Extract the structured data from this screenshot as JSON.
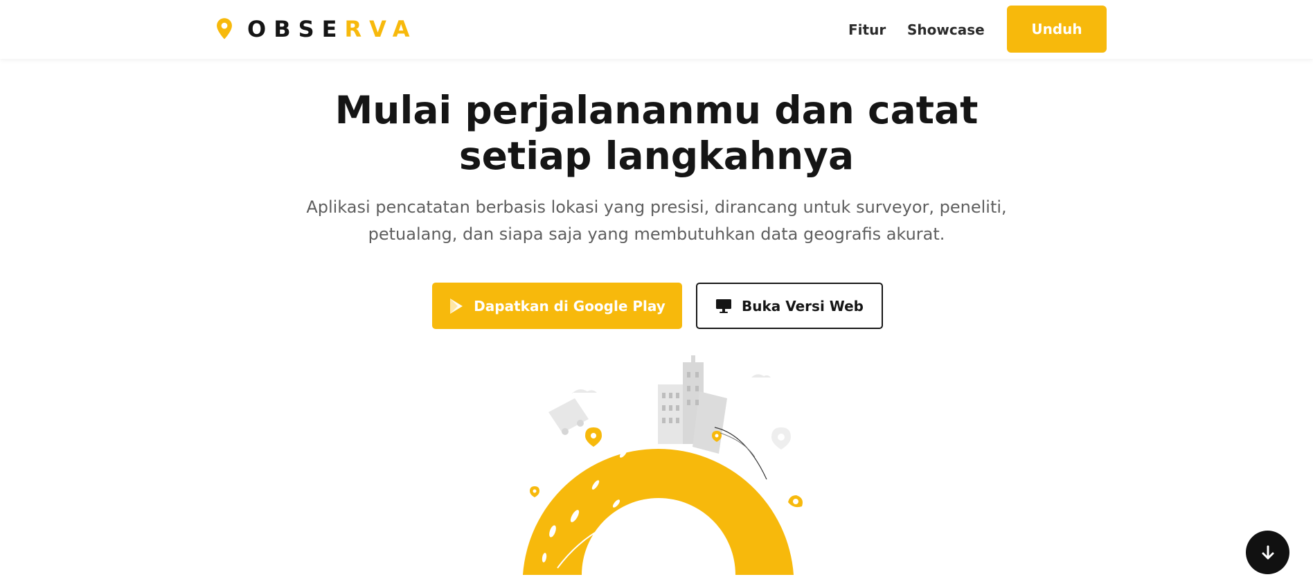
{
  "header": {
    "logo_dark": "OBSE",
    "logo_accent": "RVA",
    "logo_icon": "map-pin-icon",
    "nav": [
      {
        "label": "Fitur"
      },
      {
        "label": "Showcase"
      }
    ],
    "download_label": "Unduh"
  },
  "hero": {
    "title_line1": "Mulai perjalananmu dan catat",
    "title_line2": "setiap langkahnya",
    "subtitle_line1": "Aplikasi pencatatan berbasis lokasi yang presisi, dirancang untuk surveyor, peneliti,",
    "subtitle_line2": "petualang, dan siapa saja yang membutuhkan data geografis akurat.",
    "primary_cta": {
      "label": "Dapatkan di Google Play",
      "icon": "google-play-icon"
    },
    "secondary_cta": {
      "label": "Buka Versi Web",
      "icon": "monitor-icon"
    }
  },
  "illustration": {
    "name": "city-on-globe-illustration"
  },
  "scroll_button": {
    "icon": "arrow-down-icon"
  },
  "colors": {
    "accent": "#f7b90c",
    "text_dark": "#151515",
    "text_muted": "#5e5e5e",
    "background": "#ffffff"
  }
}
